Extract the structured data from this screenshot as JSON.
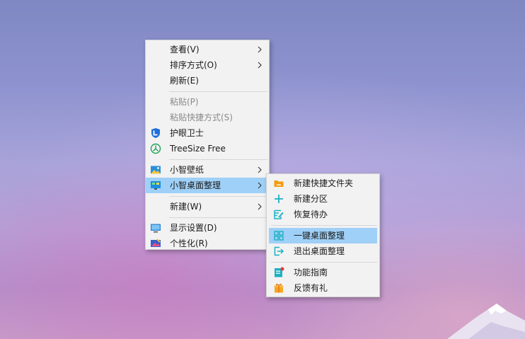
{
  "main_menu": {
    "items": [
      {
        "label": "查看(V)"
      },
      {
        "label": "排序方式(O)"
      },
      {
        "label": "刷新(E)"
      },
      {
        "label": "粘贴(P)"
      },
      {
        "label": "粘贴快捷方式(S)"
      },
      {
        "label": "护眼卫士"
      },
      {
        "label": "TreeSize Free"
      },
      {
        "label": "小智壁纸"
      },
      {
        "label": "小智桌面整理"
      },
      {
        "label": "新建(W)"
      },
      {
        "label": "显示设置(D)"
      },
      {
        "label": "个性化(R)"
      }
    ]
  },
  "sub_menu": {
    "items": [
      {
        "label": "新建快捷文件夹"
      },
      {
        "label": "新建分区"
      },
      {
        "label": "恢复待办"
      },
      {
        "label": "一键桌面整理"
      },
      {
        "label": "退出桌面整理"
      },
      {
        "label": "功能指南"
      },
      {
        "label": "反馈有礼"
      }
    ]
  },
  "colors": {
    "menu_bg": "#f2f2f2",
    "highlight": "#9fd0f7",
    "disabled_text": "#8a8a8a",
    "accent_orange": "#f39c12",
    "accent_teal": "#1bb1c4"
  }
}
